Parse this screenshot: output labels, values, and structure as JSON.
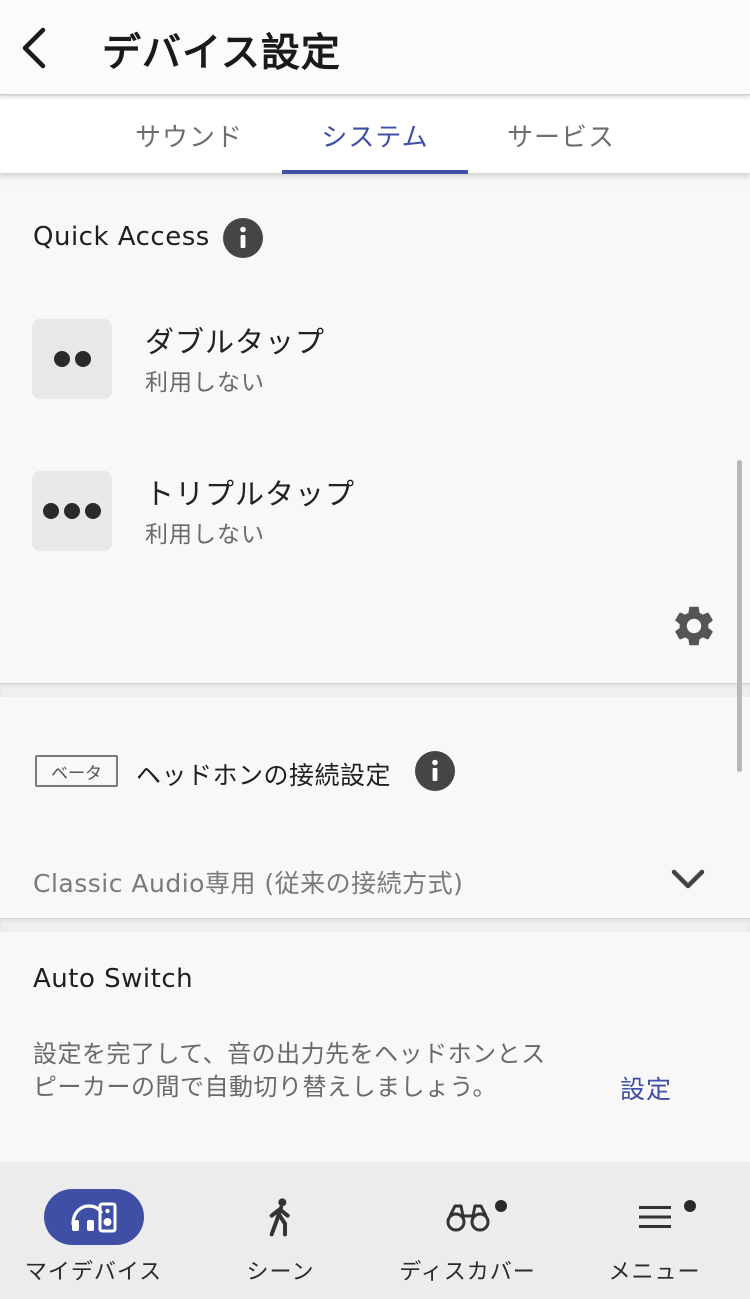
{
  "header": {
    "title": "デバイス設定",
    "back_icon": "chevron-left-icon"
  },
  "tabs": [
    {
      "label": "サウンド",
      "active": false
    },
    {
      "label": "システム",
      "active": true
    },
    {
      "label": "サービス",
      "active": false
    }
  ],
  "quick_access": {
    "title": "Quick Access",
    "info_icon": "info-icon",
    "items": [
      {
        "name": "ダブルタップ",
        "value": "利用しない",
        "icon": "double-dot-icon"
      },
      {
        "name": "トリプルタップ",
        "value": "利用しない",
        "icon": "triple-dot-icon"
      }
    ],
    "settings_icon": "gear-icon"
  },
  "connection": {
    "badge": "ベータ",
    "title": "ヘッドホンの接続設定",
    "info_icon": "info-icon",
    "selected": "Classic Audio専用 (従来の接続方式)",
    "dropdown_icon": "chevron-down-icon"
  },
  "auto_switch": {
    "title": "Auto Switch",
    "description": "設定を完了して、音の出力先をヘッドホンとスピーカーの間で自動切り替えしましょう。",
    "action_label": "設定"
  },
  "bottom_nav": [
    {
      "label": "マイデバイス",
      "icon": "headphones-speaker-icon",
      "active": true
    },
    {
      "label": "シーン",
      "icon": "walking-person-icon",
      "active": false
    },
    {
      "label": "ディスカバー",
      "icon": "binoculars-icon",
      "active": false,
      "has_dot": true
    },
    {
      "label": "メニュー",
      "icon": "hamburger-menu-icon",
      "active": false,
      "has_dot": true
    }
  ],
  "colors": {
    "accent": "#3f4fa6",
    "background": "#f8f8f8",
    "nav_background": "#ececec"
  }
}
